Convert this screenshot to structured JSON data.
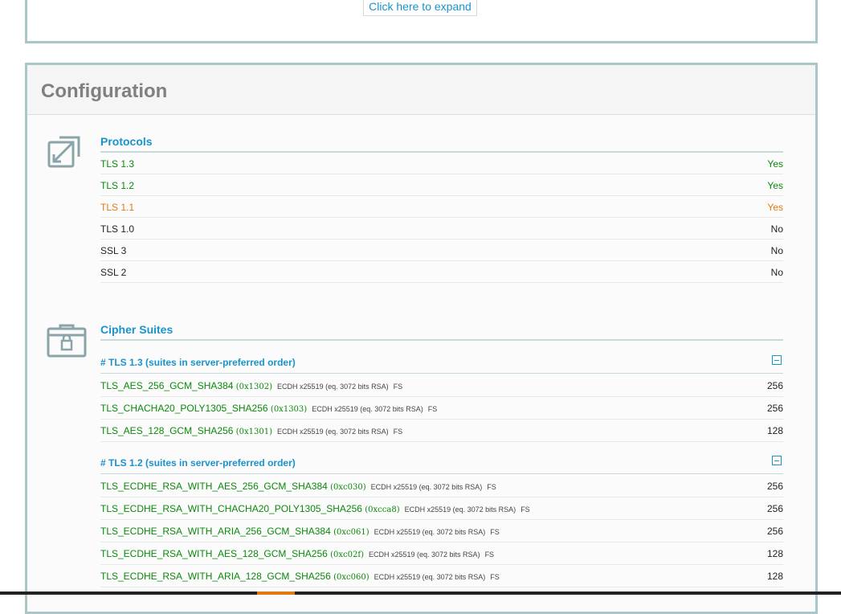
{
  "top_panel": {
    "expand_label": "Click here to expand"
  },
  "config": {
    "title": "Configuration",
    "protocols": {
      "title": "Protocols",
      "icon": "resize-arrows-icon",
      "rows": [
        {
          "name": "TLS 1.3",
          "value": "Yes",
          "status": "green"
        },
        {
          "name": "TLS 1.2",
          "value": "Yes",
          "status": "green"
        },
        {
          "name": "TLS 1.1",
          "value": "Yes",
          "status": "orange"
        },
        {
          "name": "TLS 1.0",
          "value": "No",
          "status": "black"
        },
        {
          "name": "SSL 3",
          "value": "No",
          "status": "black"
        },
        {
          "name": "SSL 2",
          "value": "No",
          "status": "black"
        }
      ]
    },
    "ciphers": {
      "title": "Cipher Suites",
      "icon": "lock-case-icon",
      "groups": [
        {
          "title": "# TLS 1.3 (suites in server-preferred order)",
          "suites": [
            {
              "name": "TLS_AES_256_GCM_SHA384",
              "code": "(0x1302)",
              "detail": "ECDH x25519 (eq. 3072 bits RSA)",
              "fs": "FS",
              "bits": "256"
            },
            {
              "name": "TLS_CHACHA20_POLY1305_SHA256",
              "code": "(0x1303)",
              "detail": "ECDH x25519 (eq. 3072 bits RSA)",
              "fs": "FS",
              "bits": "256"
            },
            {
              "name": "TLS_AES_128_GCM_SHA256",
              "code": "(0x1301)",
              "detail": "ECDH x25519 (eq. 3072 bits RSA)",
              "fs": "FS",
              "bits": "128"
            }
          ]
        },
        {
          "title": "# TLS 1.2 (suites in server-preferred order)",
          "suites": [
            {
              "name": "TLS_ECDHE_RSA_WITH_AES_256_GCM_SHA384",
              "code": "(0xc030)",
              "detail": "ECDH x25519 (eq. 3072 bits RSA)",
              "fs": "FS",
              "bits": "256"
            },
            {
              "name": "TLS_ECDHE_RSA_WITH_CHACHA20_POLY1305_SHA256",
              "code": "(0xcca8)",
              "detail": "ECDH x25519 (eq. 3072 bits RSA)",
              "fs": "FS",
              "bits": "256"
            },
            {
              "name": "TLS_ECDHE_RSA_WITH_ARIA_256_GCM_SHA384",
              "code": "(0xc061)",
              "detail": "ECDH x25519 (eq. 3072 bits RSA)",
              "fs": "FS",
              "bits": "256"
            },
            {
              "name": "TLS_ECDHE_RSA_WITH_AES_128_GCM_SHA256",
              "code": "(0xc02f)",
              "detail": "ECDH x25519 (eq. 3072 bits RSA)",
              "fs": "FS",
              "bits": "128"
            },
            {
              "name": "TLS_ECDHE_RSA_WITH_ARIA_128_GCM_SHA256",
              "code": "(0xc060)",
              "detail": "ECDH x25519 (eq. 3072 bits RSA)",
              "fs": "FS",
              "bits": "128"
            }
          ]
        }
      ]
    }
  },
  "colors": {
    "accent": "#1a93cc",
    "good": "#0a8a0a",
    "warn": "#e07b14",
    "border": "#a9c7c7"
  }
}
